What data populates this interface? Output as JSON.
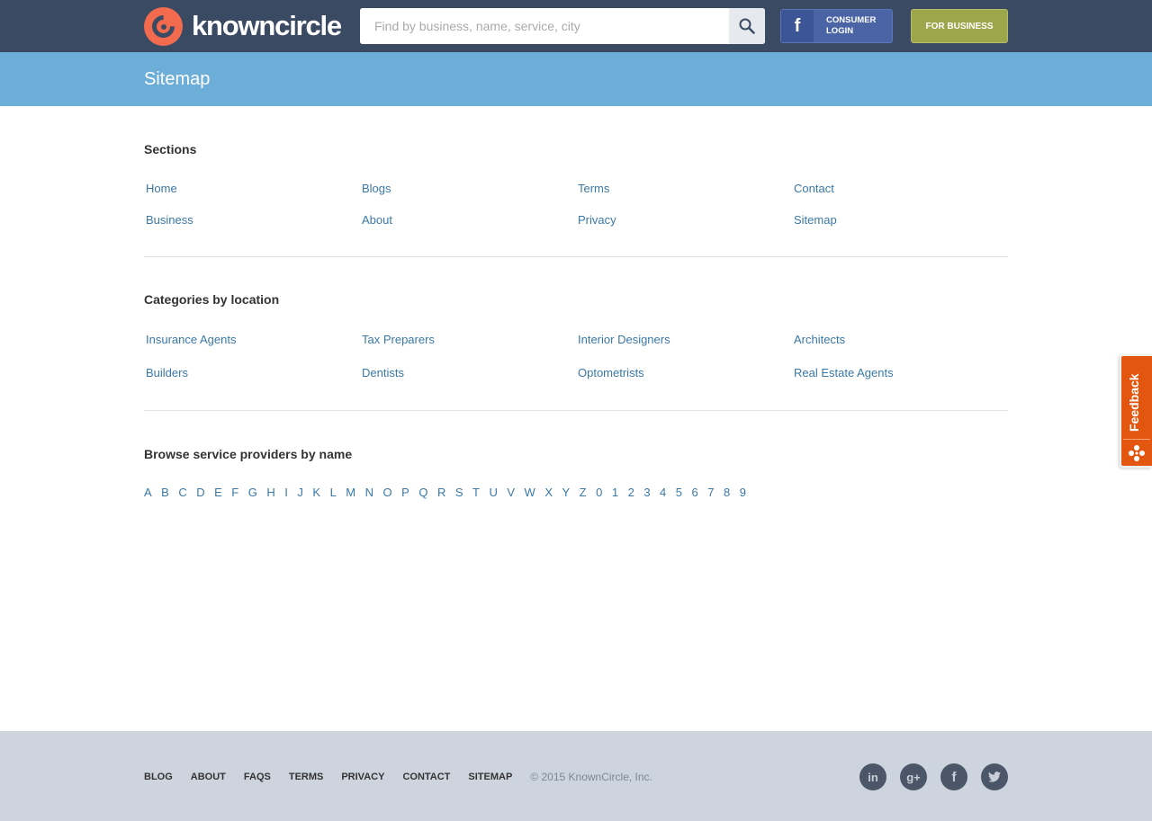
{
  "header": {
    "brand": "knowncircle",
    "search_placeholder": "Find by business, name, service, city",
    "consumer_login": "CONSUMER LOGIN",
    "fb_letter": "f",
    "for_business": "FOR BUSINESS"
  },
  "page_title": "Sitemap",
  "sections": {
    "heading": "Sections",
    "links": [
      "Home",
      "Blogs",
      "Terms",
      "Contact",
      "Business",
      "About",
      "Privacy",
      "Sitemap"
    ]
  },
  "categories": {
    "heading": "Categories by location",
    "links": [
      "Insurance Agents",
      "Tax Preparers",
      "Interior Designers",
      "Architects",
      "Builders",
      "Dentists",
      "Optometrists",
      "Real Estate Agents"
    ]
  },
  "browse": {
    "heading": "Browse service providers by name",
    "letters": [
      "A",
      "B",
      "C",
      "D",
      "E",
      "F",
      "G",
      "H",
      "I",
      "J",
      "K",
      "L",
      "M",
      "N",
      "O",
      "P",
      "Q",
      "R",
      "S",
      "T",
      "U",
      "V",
      "W",
      "X",
      "Y",
      "Z",
      "0",
      "1",
      "2",
      "3",
      "4",
      "5",
      "6",
      "7",
      "8",
      "9"
    ]
  },
  "feedback": {
    "label": "Feedback"
  },
  "footer": {
    "links": [
      "BLOG",
      "ABOUT",
      "FAQS",
      "TERMS",
      "PRIVACY",
      "CONTACT",
      "SITEMAP"
    ],
    "copyright": "© 2015 KnownCircle, Inc.",
    "social": {
      "linkedin": "in",
      "googleplus": "g+",
      "facebook": "f"
    }
  },
  "colors": {
    "topbar": "#3a4a63",
    "titlebar": "#6daed9",
    "link": "#3a78a8",
    "brand_accent": "#f26b4f",
    "for_business": "#9ea64c",
    "facebook": "#4a64a5",
    "feedback": "#e3560f",
    "footer": "#cdd4de"
  }
}
